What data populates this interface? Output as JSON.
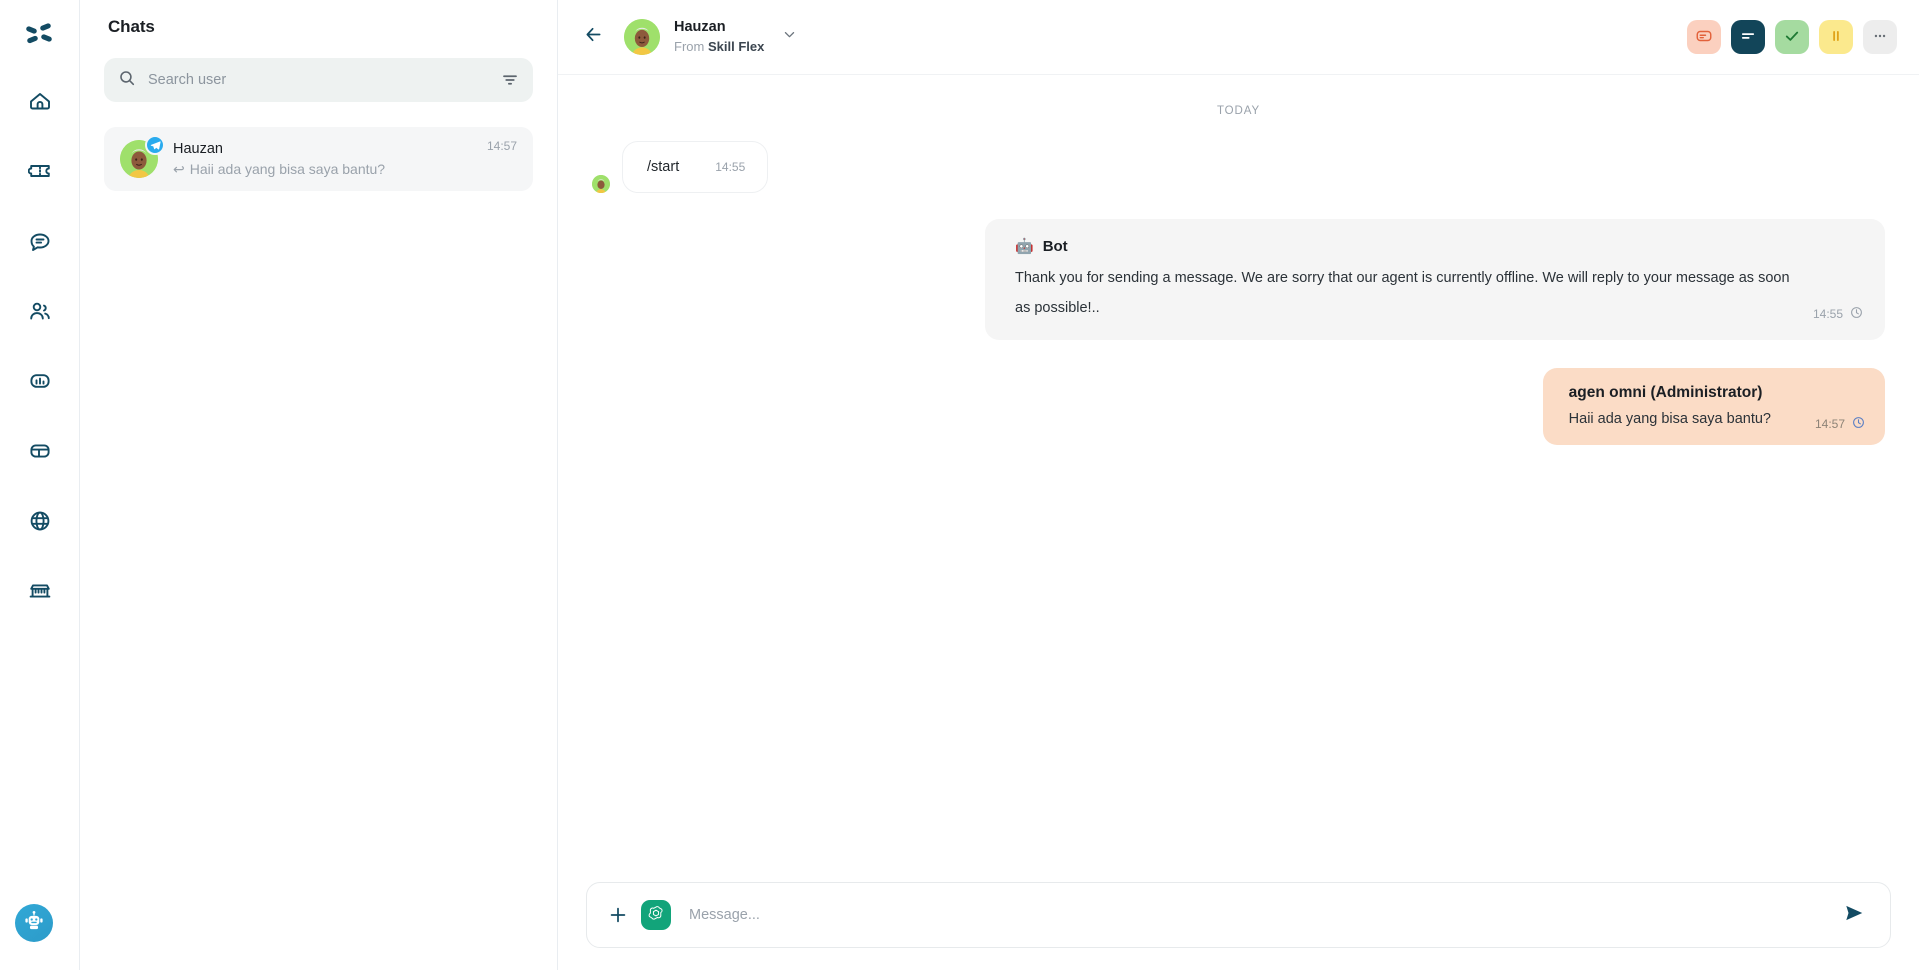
{
  "colors": {
    "rail_icon": "#134b63",
    "accent_teal": "#12a47a",
    "telegram_blue": "#2aabee",
    "bubble_out_bg": "#fbdcc6",
    "bubble_bot_bg": "#f5f5f5",
    "btn_note_bg": "#f8815a",
    "btn_transcript_bg": "#124559",
    "btn_resolve_bg": "#a5dba0",
    "btn_pending_bg": "#fbe98d",
    "btn_more_bg": "#ededed"
  },
  "rail": {
    "logo_name": "app-logo",
    "items": [
      {
        "name": "home-icon",
        "label": "Home"
      },
      {
        "name": "ticket-icon",
        "label": "Tickets"
      },
      {
        "name": "chat-icon",
        "label": "Chats"
      },
      {
        "name": "contacts-icon",
        "label": "Contacts"
      },
      {
        "name": "analytics-icon",
        "label": "Analytics"
      },
      {
        "name": "layers-icon",
        "label": "Modules"
      },
      {
        "name": "globe-icon",
        "label": "Channels"
      },
      {
        "name": "marketplace-icon",
        "label": "Marketplace"
      }
    ],
    "bot_button_label": "bot-assistant"
  },
  "list_panel": {
    "title": "Chats",
    "search": {
      "placeholder": "Search user",
      "value": "",
      "icon": "search-icon",
      "filter_icon": "filter-icon"
    },
    "chats": [
      {
        "name": "Hauzan",
        "snippet": "Haii ada yang bisa saya bantu?",
        "reply_marker": "↩",
        "time": "14:57",
        "channel": "telegram",
        "selected": true
      }
    ]
  },
  "conversation": {
    "header": {
      "back_icon": "back-arrow-icon",
      "name": "Hauzan",
      "from_label": "From",
      "from_value": "Skill Flex",
      "caret_icon": "chevron-down-icon",
      "actions": [
        {
          "name": "note-button",
          "icon": "note-icon",
          "label": "Note",
          "bg": "#fbd0bf",
          "fg": "#e2613a"
        },
        {
          "name": "transcript-button",
          "icon": "transcript-icon",
          "label": "Transcript",
          "bg": "#124559",
          "fg": "#ffffff"
        },
        {
          "name": "resolve-button",
          "icon": "check-icon",
          "label": "Resolve",
          "bg": "#a5dba0",
          "fg": "#1f7a34"
        },
        {
          "name": "pending-button",
          "icon": "pause-icon",
          "label": "Pending",
          "bg": "#fbe98d",
          "fg": "#e0a318"
        },
        {
          "name": "more-button",
          "icon": "ellipsis-icon",
          "label": "More",
          "bg": "#ededed",
          "fg": "#666d74"
        }
      ]
    },
    "day_divider": "TODAY",
    "messages": [
      {
        "kind": "incoming",
        "text": "/start",
        "time": "14:55"
      },
      {
        "kind": "bot",
        "sender": "Bot",
        "sender_icon": "🤖",
        "text": "Thank you for sending a message. We are sorry that our agent is currently offline. We will reply to your message as soon as possible!..",
        "time": "14:55",
        "status_icon": "clock-icon"
      },
      {
        "kind": "outgoing",
        "sender": "agen omni (Administrator)",
        "text": "Haii ada yang bisa saya bantu?",
        "time": "14:57",
        "status_icon": "clock-icon"
      }
    ],
    "composer": {
      "plus_icon": "plus-icon",
      "ai_icon": "openai-icon",
      "placeholder": "Message...",
      "value": "",
      "send_icon": "send-icon"
    }
  }
}
